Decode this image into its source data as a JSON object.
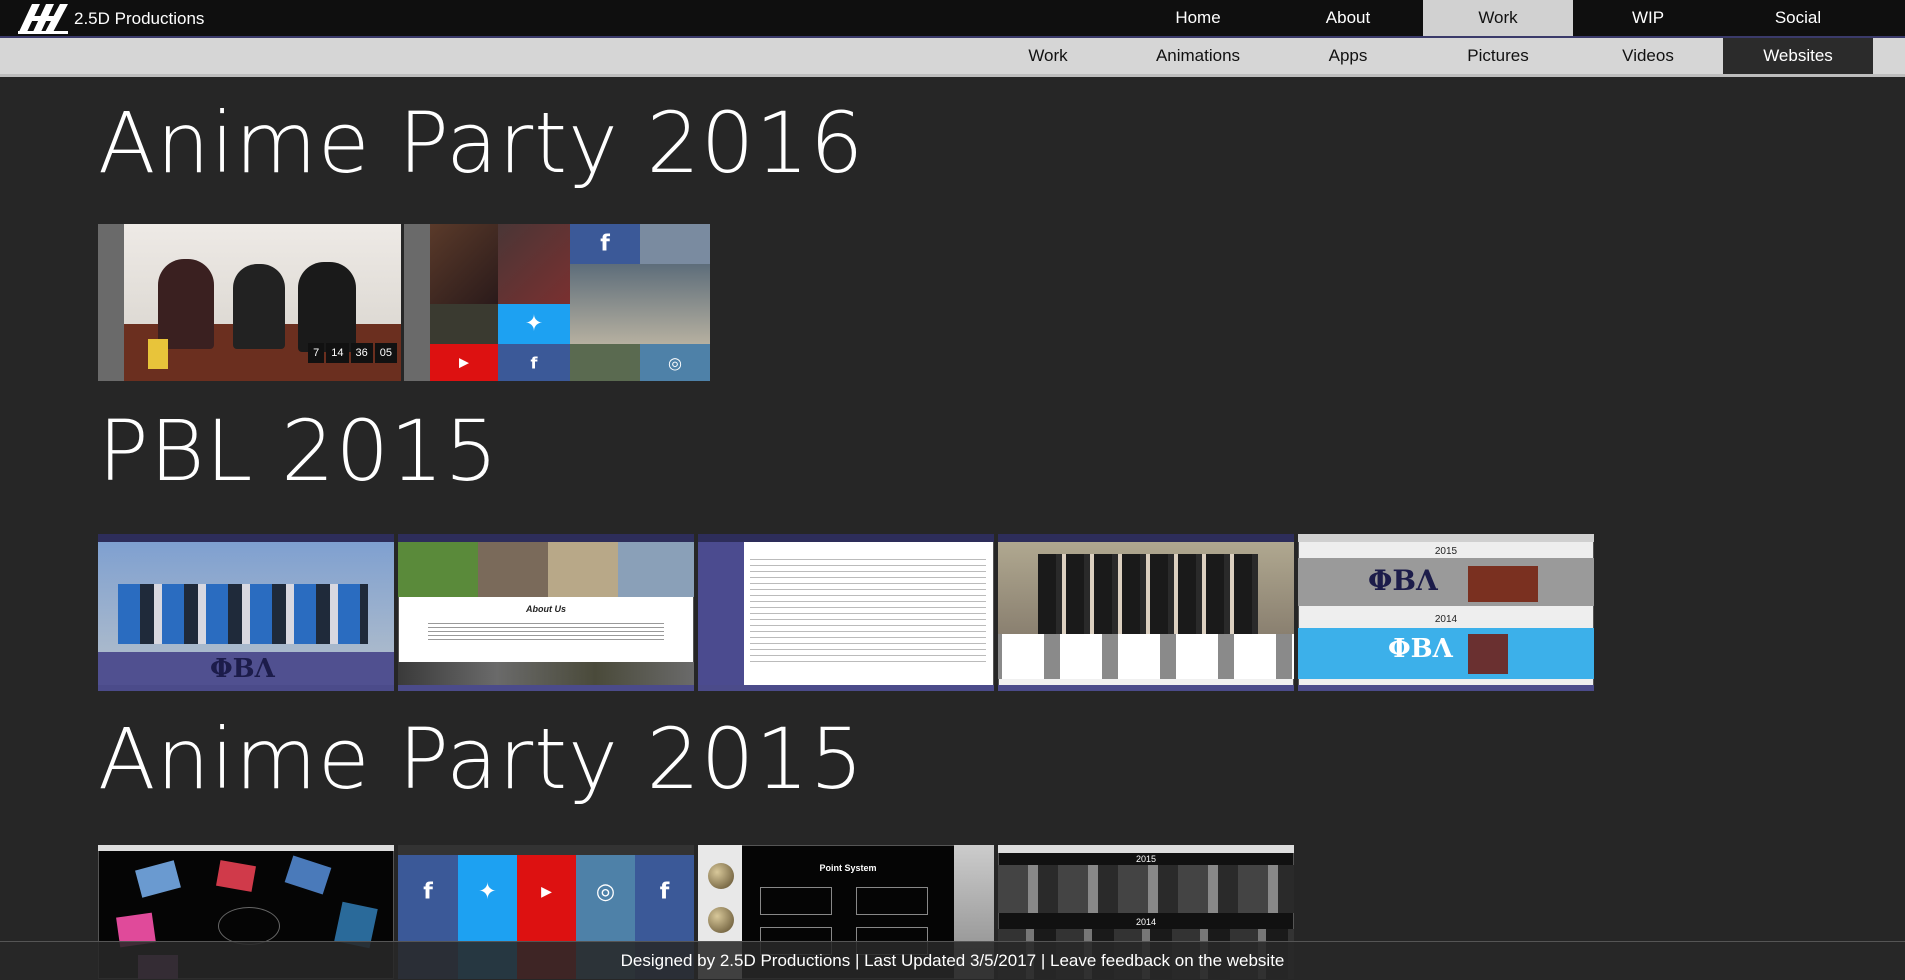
{
  "brand": {
    "name": "2.5D Productions",
    "logo_icon": "logo-xh-icon"
  },
  "top_nav": [
    {
      "label": "Home",
      "active": false
    },
    {
      "label": "About",
      "active": false
    },
    {
      "label": "Work",
      "active": true
    },
    {
      "label": "WIP",
      "active": false
    },
    {
      "label": "Social",
      "active": false
    }
  ],
  "sub_nav": [
    {
      "label": "Work",
      "active": false
    },
    {
      "label": "Animations",
      "active": false
    },
    {
      "label": "Apps",
      "active": false
    },
    {
      "label": "Pictures",
      "active": false
    },
    {
      "label": "Videos",
      "active": false
    },
    {
      "label": "Websites",
      "active": true
    }
  ],
  "sections": [
    {
      "title": "Anime Party 2016",
      "thumb_count": 2
    },
    {
      "title": "PBL 2015",
      "thumb_count": 5
    },
    {
      "title": "Anime Party 2015",
      "thumb_count": 4
    }
  ],
  "thumb_text": {
    "timer": [
      "7",
      "14",
      "36",
      "05"
    ],
    "pbl_greek": "ΦΒΛ",
    "pbl_about": "About Us",
    "pbl_year_a": "2015",
    "pbl_year_b": "2014",
    "ap15_points": "Point System",
    "ap15_year_a": "2015",
    "ap15_year_b": "2014"
  },
  "footer": {
    "text": "Designed by 2.5D Productions | Last Updated 3/5/2017 | Leave feedback on the website"
  },
  "colors": {
    "background": "#262626",
    "topbar": "#0f0f0f",
    "subbar": "#d6d6d6",
    "facebook": "#3b5998",
    "twitter": "#1da1f2",
    "youtube": "#dd1111",
    "instagram": "#4e81a8"
  }
}
